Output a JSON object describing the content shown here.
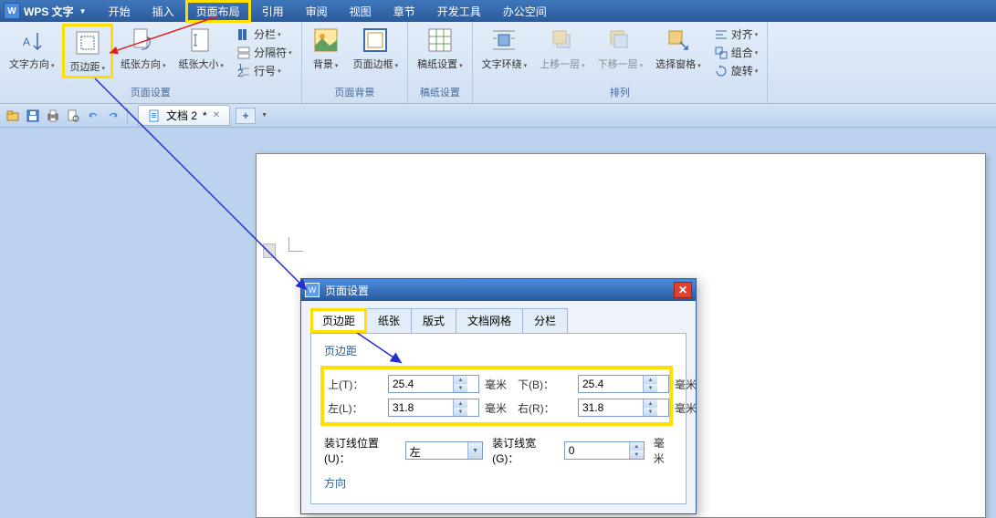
{
  "app": {
    "title": "WPS 文字"
  },
  "menu": {
    "items": [
      "开始",
      "插入",
      "页面布局",
      "引用",
      "审阅",
      "视图",
      "章节",
      "开发工具",
      "办公空间"
    ],
    "active_index": 2
  },
  "ribbon": {
    "groups": [
      {
        "label": "页面设置",
        "big": [
          {
            "label": "文字方向",
            "name": "text-direction"
          },
          {
            "label": "页边距",
            "name": "margins",
            "highlighted": true
          },
          {
            "label": "纸张方向",
            "name": "orientation"
          },
          {
            "label": "纸张大小",
            "name": "paper-size"
          }
        ],
        "small": [
          {
            "label": "分栏",
            "name": "columns"
          },
          {
            "label": "分隔符",
            "name": "breaks"
          },
          {
            "label": "行号",
            "name": "line-numbers"
          }
        ]
      },
      {
        "label": "页面背景",
        "big": [
          {
            "label": "背景",
            "name": "background"
          },
          {
            "label": "页面边框",
            "name": "page-border"
          }
        ]
      },
      {
        "label": "稿纸设置",
        "big": [
          {
            "label": "稿纸设置",
            "name": "genko"
          }
        ]
      },
      {
        "label": "排列",
        "big": [
          {
            "label": "文字环绕",
            "name": "text-wrap"
          },
          {
            "label": "上移一层",
            "name": "bring-forward",
            "disabled": true
          },
          {
            "label": "下移一层",
            "name": "send-backward",
            "disabled": true
          },
          {
            "label": "选择窗格",
            "name": "selection-pane"
          }
        ],
        "small": [
          {
            "label": "对齐",
            "name": "align"
          },
          {
            "label": "组合",
            "name": "group"
          },
          {
            "label": "旋转",
            "name": "rotate"
          }
        ]
      }
    ]
  },
  "doc_tab": {
    "label": "文档 2"
  },
  "dialog": {
    "title": "页面设置",
    "tabs": [
      "页边距",
      "纸张",
      "版式",
      "文档网格",
      "分栏"
    ],
    "active_tab": 0,
    "margins_section": "页边距",
    "labels": {
      "top": "上(T)：",
      "bottom": "下(B)：",
      "left": "左(L)：",
      "right": "右(R)：",
      "unit": "毫米",
      "gutter_pos": "装订线位置(U)：",
      "gutter_width": "装订线宽(G)："
    },
    "values": {
      "top": "25.4",
      "bottom": "25.4",
      "left": "31.8",
      "right": "31.8",
      "gutter_pos": "左",
      "gutter_width": "0"
    },
    "orientation_label": "方向"
  }
}
